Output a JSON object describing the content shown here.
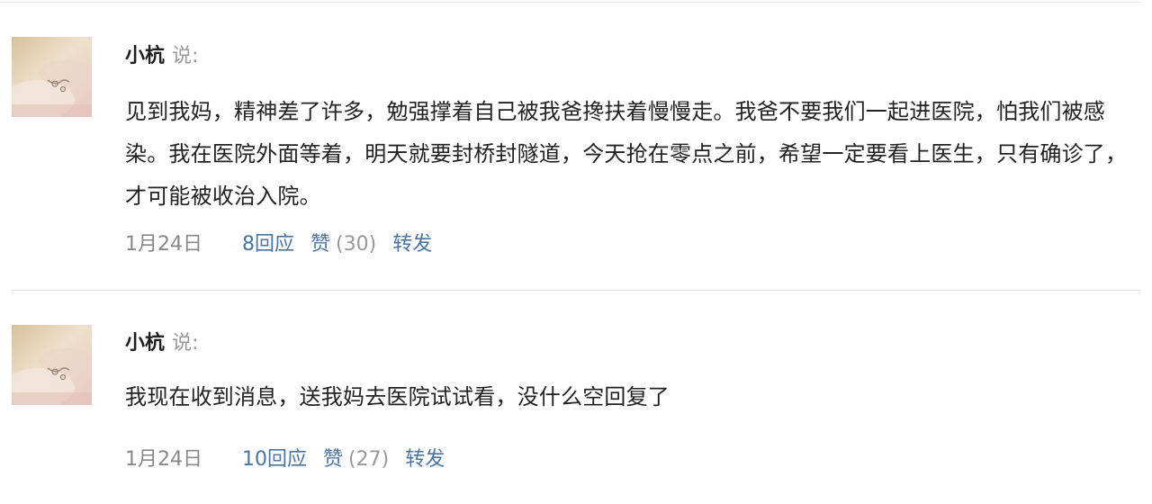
{
  "posts": [
    {
      "author": "小杭",
      "say_label": "说:",
      "text": "见到我妈，精神差了许多，勉强撑着自己被我爸搀扶着慢慢走。我爸不要我们一起进医院，怕我们被感染。我在医院外面等着，明天就要封桥封隧道，今天抢在零点之前，希望一定要看上医生，只有确诊了，才可能被收治入院。",
      "date": "1月24日",
      "replies": "8回应",
      "like_label": "赞",
      "like_count": "(30)",
      "share": "转发"
    },
    {
      "author": "小杭",
      "say_label": "说:",
      "text": "我现在收到消息，送我妈去医院试试看，没什么空回复了",
      "date": "1月24日",
      "replies": "10回应",
      "like_label": "赞",
      "like_count": "(27)",
      "share": "转发"
    }
  ],
  "colors": {
    "link": "#4c74a0",
    "muted": "#888888",
    "text": "#222222",
    "divider": "#e4e4e4"
  }
}
